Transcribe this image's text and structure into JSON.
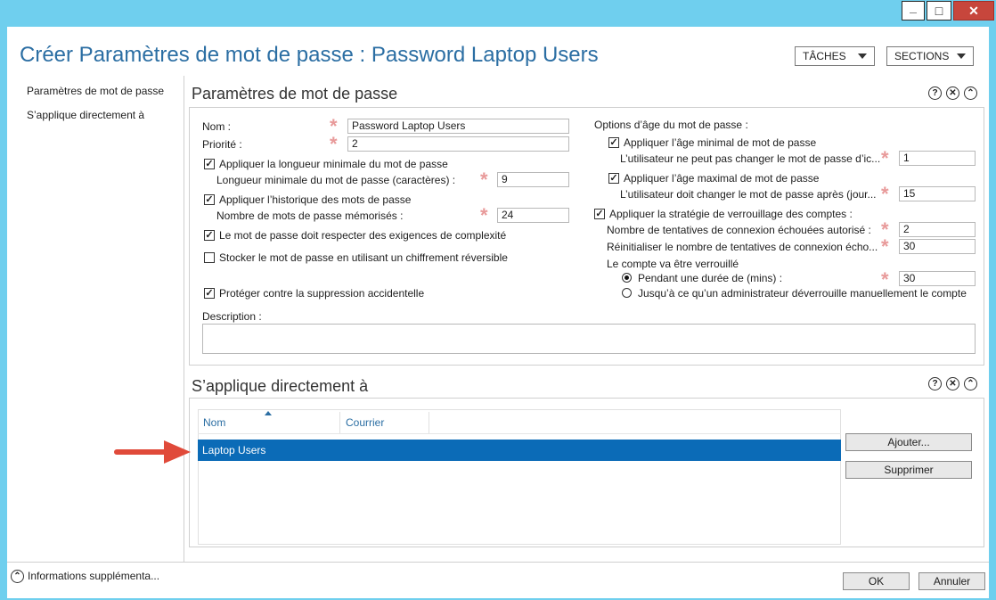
{
  "window_controls": {
    "minimize": "_",
    "maximize": "□",
    "close": "✕"
  },
  "title": "Créer Paramètres de mot de passe : Password Laptop Users",
  "tasks_label": "TÂCHES",
  "sections_label": "SECTIONS",
  "nav": [
    "Paramètres de mot de passe",
    "S’applique directement à"
  ],
  "pwd_section": {
    "heading": "Paramètres de mot de passe",
    "name_label": "Nom :",
    "name_value": "Password Laptop Users",
    "priority_label": "Priorité :",
    "priority_value": "2",
    "min_length_check": "Appliquer la longueur minimale du mot de passe",
    "min_length_label": "Longueur minimale du mot de passe (caractères) :",
    "min_length_value": "9",
    "history_check": "Appliquer l’historique des mots de passe",
    "history_label": "Nombre de mots de passe mémorisés :",
    "history_value": "24",
    "complexity_check": "Le mot de passe doit respecter des exigences de complexité",
    "reversible_check": "Stocker le mot de passe en utilisant un chiffrement réversible",
    "protect_check": "Protéger contre la suppression accidentelle",
    "description_label": "Description :",
    "age_options_label": "Options d’âge du mot de passe :",
    "min_age_check": "Appliquer l’âge minimal de mot de passe",
    "min_age_label": "L’utilisateur ne peut pas changer le mot de passe d’ic...",
    "min_age_value": "1",
    "max_age_check": "Appliquer l’âge maximal de mot de passe",
    "max_age_label": "L’utilisateur doit changer le mot de passe après (jour...",
    "max_age_value": "15",
    "lockout_check": "Appliquer la stratégie de verrouillage des comptes :",
    "failed_label": "Nombre de tentatives de connexion échouées autorisé :",
    "failed_value": "2",
    "reset_label": "Réinitialiser le nombre de tentatives de connexion écho...",
    "reset_value": "30",
    "locked_label": "Le compte va être verrouillé",
    "duration_radio": "Pendant une durée de (mins) :",
    "duration_value": "30",
    "admin_radio": "Jusqu’à ce qu’un administrateur déverrouille manuellement le compte"
  },
  "applies_section": {
    "heading": "S’applique directement à",
    "col_name": "Nom",
    "col_mail": "Courrier",
    "row": "Laptop Users",
    "add_button": "Ajouter...",
    "remove_button": "Supprimer"
  },
  "panel_icons": {
    "help": "?",
    "close": "✕",
    "collapse": "⌃"
  },
  "footer": {
    "more_info": "Informations supplémenta...",
    "ok": "OK",
    "cancel": "Annuler"
  },
  "colors": {
    "accent": "#2b6ea3",
    "selection": "#0b6bb7",
    "background": "#6fcfee",
    "required": "#e89a9a",
    "arrow": "#e04a3a"
  }
}
